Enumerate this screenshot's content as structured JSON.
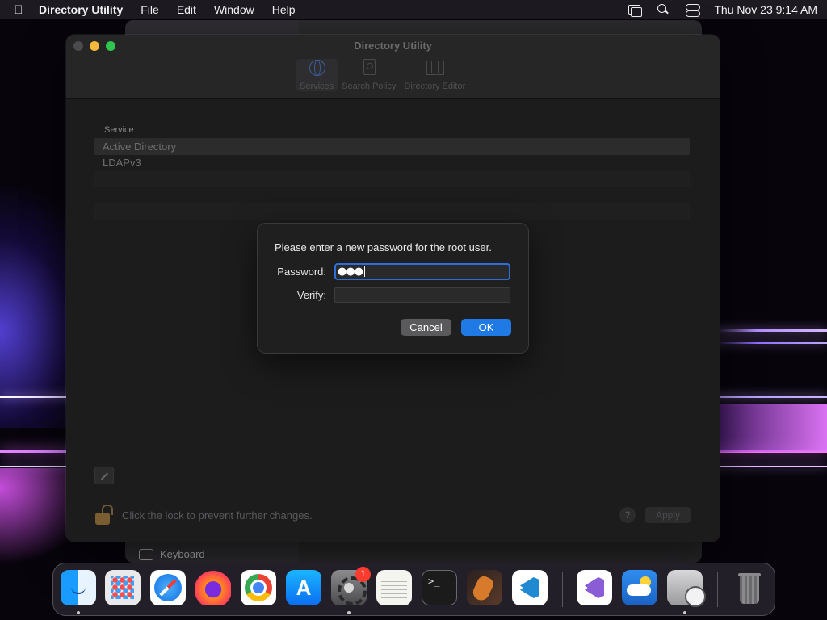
{
  "menubar": {
    "app_name": "Directory Utility",
    "menus": [
      "File",
      "Edit",
      "Window",
      "Help"
    ],
    "clock": "Thu Nov 23  9:14 AM"
  },
  "back_window": {
    "sidebar_item": "Keyboard"
  },
  "window": {
    "title": "Directory Utility",
    "toolbar": [
      {
        "label": "Services",
        "icon": "globe-icon",
        "selected": true
      },
      {
        "label": "Search Policy",
        "icon": "doc-search-icon",
        "selected": false
      },
      {
        "label": "Directory Editor",
        "icon": "map-icon",
        "selected": false
      }
    ],
    "table": {
      "header": "Service",
      "rows": [
        "Active Directory",
        "LDAPv3"
      ]
    },
    "lock_text": "Click the lock to prevent further changes.",
    "help_label": "?",
    "apply_label": "Apply"
  },
  "dialog": {
    "message": "Please enter a new password for the root user.",
    "password_label": "Password:",
    "password_value": "●●●",
    "verify_label": "Verify:",
    "verify_value": "",
    "cancel_label": "Cancel",
    "ok_label": "OK",
    "accent_color": "#1f7ae6"
  },
  "dock": {
    "apps": [
      {
        "name": "Finder",
        "icon": "finder-icon",
        "running": true
      },
      {
        "name": "Launchpad",
        "icon": "launchpad-icon",
        "running": false
      },
      {
        "name": "Safari",
        "icon": "safari-icon",
        "running": false
      },
      {
        "name": "Firefox",
        "icon": "firefox-icon",
        "running": false
      },
      {
        "name": "Google Chrome",
        "icon": "chrome-icon",
        "running": false
      },
      {
        "name": "App Store",
        "icon": "appstore-icon",
        "running": false
      },
      {
        "name": "System Settings",
        "icon": "settings-icon",
        "running": true,
        "badge": "1"
      },
      {
        "name": "TextEdit",
        "icon": "textedit-icon",
        "running": false
      },
      {
        "name": "Terminal",
        "icon": "terminal-icon",
        "running": false
      },
      {
        "name": "GarageBand",
        "icon": "garageband-icon",
        "running": false
      },
      {
        "name": "Visual Studio Code",
        "icon": "vscode-icon",
        "running": false
      },
      {
        "name": "Visual Studio",
        "icon": "visualstudio-icon",
        "running": false
      },
      {
        "name": "Weather",
        "icon": "weather-icon",
        "running": false
      },
      {
        "name": "Directory Utility",
        "icon": "directory-utility-icon",
        "running": true
      },
      {
        "name": "Trash",
        "icon": "trash-icon",
        "running": false
      }
    ]
  }
}
